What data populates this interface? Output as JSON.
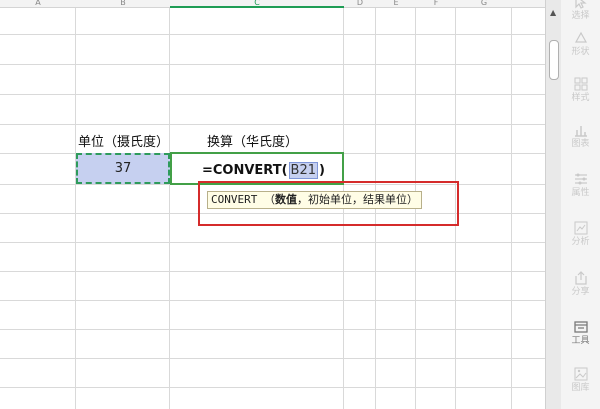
{
  "spreadsheet": {
    "column_headers": [
      "A",
      "B",
      "C",
      "D",
      "E",
      "F",
      "G"
    ],
    "header_row": {
      "b": "单位（摄氏度）",
      "c": "换算（华氏度）"
    },
    "value_row": {
      "b": "37",
      "formula_prefix": "=CONVERT(",
      "formula_ref": "B21",
      "formula_suffix": ")"
    },
    "tooltip": {
      "function": "CONVERT",
      "open": "（",
      "arg_number": "数值",
      "rest": "，初始单位，结果单位）"
    }
  },
  "right_sidebar": {
    "items": [
      {
        "label": "选择",
        "icon": "select-icon"
      },
      {
        "label": "形状",
        "icon": "shape-icon"
      },
      {
        "label": "样式",
        "icon": "style-icon"
      },
      {
        "label": "图表",
        "icon": "chart-icon"
      },
      {
        "label": "属性",
        "icon": "properties-icon"
      },
      {
        "label": "分析",
        "icon": "analyze-icon"
      },
      {
        "label": "分享",
        "icon": "share-icon"
      },
      {
        "label": "工具",
        "icon": "tools-icon"
      },
      {
        "label": "图库",
        "icon": "gallery-icon"
      }
    ]
  },
  "colors": {
    "selection_fill": "#c6d0f0",
    "edit_border": "#43a047",
    "highlight_border": "#d52b2b",
    "tooltip_bg": "#fffde6"
  }
}
